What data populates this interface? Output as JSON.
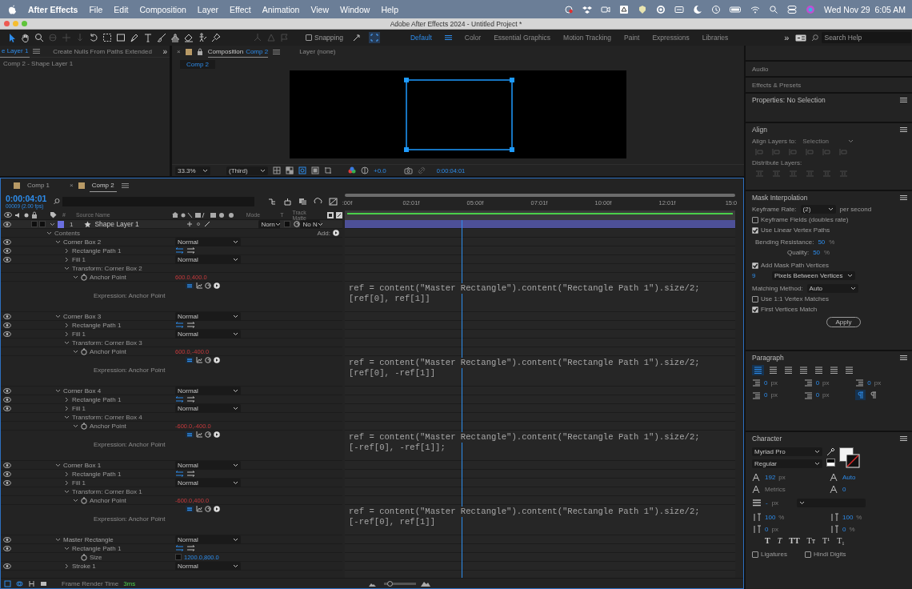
{
  "menu_bar": {
    "app": "After Effects",
    "items": [
      "File",
      "Edit",
      "Composition",
      "Layer",
      "Effect",
      "Animation",
      "View",
      "Window",
      "Help"
    ],
    "clock": "Wed Nov 29  6:05 AM"
  },
  "window": {
    "title": "Adobe After Effects 2024 - Untitled Project *"
  },
  "toolbar": {
    "snapping": {
      "label": "Snapping",
      "checked": false
    },
    "workspaces": [
      {
        "label": "Default",
        "selected": true
      },
      {
        "label": "Color",
        "selected": false
      },
      {
        "label": "Essential Graphics",
        "selected": false
      },
      {
        "label": "Motion Tracking",
        "selected": false
      },
      {
        "label": "Paint",
        "selected": false
      },
      {
        "label": "Expressions",
        "selected": false
      },
      {
        "label": "Libraries",
        "selected": false
      }
    ],
    "overflow": "»",
    "search": {
      "placeholder": "Search Help"
    }
  },
  "effect_controls": {
    "tabs": [
      {
        "label": "e Layer 1",
        "selected": true
      },
      {
        "label": "Create Nulls From Paths Extended",
        "selected": false
      }
    ],
    "overflow": "»",
    "breadcrumb": "Comp 2 - Shape Layer 1"
  },
  "composition_panel": {
    "tabs": [
      {
        "close": "×",
        "label": "Composition",
        "comp": "Comp 2",
        "selected": true
      },
      {
        "label": "Layer (none)",
        "selected": false
      }
    ],
    "subtab": "Comp 2",
    "viewer_bar": {
      "zoom": "33.3%",
      "resolution": "(Third)",
      "exposure": "+0.0",
      "timecode": "0:00:04:01"
    }
  },
  "timeline": {
    "tabs": [
      {
        "label": "Comp 1",
        "selected": false
      },
      {
        "close": "×",
        "label": "Comp 2",
        "selected": true
      }
    ],
    "timecode": "0:00:04:01",
    "frame_info": "00009 (2.00 fps)",
    "columns": {
      "number": "#",
      "source_name": "Source Name",
      "mode": "Mode",
      "t": "T",
      "track_matte": "Track Matte"
    },
    "ruler": [
      ":00f",
      "02:01f",
      "05:00f",
      "07:01f",
      "10:00f",
      "12:01f",
      "15:0"
    ],
    "playhead": {
      "level": 0.3
    },
    "layer": {
      "number": "1",
      "name": "Shape Layer 1",
      "eye": true,
      "expanded": true,
      "color": "#6b6fe0",
      "mode": "Norn",
      "track_matte": "No N",
      "children": [
        {
          "kind": "contents",
          "label": "Contents",
          "expanded": true,
          "add": "Add:",
          "children": [
            {
              "kind": "group",
              "label": "Corner Box 2",
              "eye": true,
              "expanded": true,
              "mode": "Normal",
              "children": [
                {
                  "kind": "path",
                  "label": "Rectangle Path 1",
                  "eye": true,
                  "expanded": false
                },
                {
                  "kind": "fill",
                  "label": "Fill 1",
                  "eye": true,
                  "expanded": false,
                  "mode": "Normal"
                },
                {
                  "kind": "transform",
                  "label": "Transform: Corner Box 2",
                  "expanded": true,
                  "children": [
                    {
                      "kind": "property",
                      "label": "Anchor Point",
                      "expanded": true,
                      "value": "600.0,400.0",
                      "expression": {
                        "label": "Expression: Anchor Point",
                        "code": [
                          "ref = content(\"Master Rectangle\").content(\"Rectangle Path 1\").size/2;",
                          "[ref[0], ref[1]]"
                        ]
                      }
                    }
                  ]
                }
              ]
            },
            {
              "kind": "group",
              "label": "Corner Box 3",
              "eye": true,
              "expanded": true,
              "mode": "Normal",
              "children": [
                {
                  "kind": "path",
                  "label": "Rectangle Path 1",
                  "eye": true,
                  "expanded": false
                },
                {
                  "kind": "fill",
                  "label": "Fill 1",
                  "eye": true,
                  "expanded": false,
                  "mode": "Normal"
                },
                {
                  "kind": "transform",
                  "label": "Transform: Corner Box 3",
                  "expanded": true,
                  "children": [
                    {
                      "kind": "property",
                      "label": "Anchor Point",
                      "expanded": true,
                      "value": "600.0,-400.0",
                      "expression": {
                        "label": "Expression: Anchor Point",
                        "code": [
                          "ref = content(\"Master Rectangle\").content(\"Rectangle Path 1\").size/2;",
                          "[ref[0], -ref[1]]"
                        ]
                      }
                    }
                  ]
                }
              ]
            },
            {
              "kind": "group",
              "label": "Corner Box 4",
              "eye": true,
              "expanded": true,
              "mode": "Normal",
              "children": [
                {
                  "kind": "path",
                  "label": "Rectangle Path 1",
                  "eye": true,
                  "expanded": false
                },
                {
                  "kind": "fill",
                  "label": "Fill 1",
                  "eye": true,
                  "expanded": false,
                  "mode": "Normal"
                },
                {
                  "kind": "transform",
                  "label": "Transform: Corner Box 4",
                  "expanded": true,
                  "children": [
                    {
                      "kind": "property",
                      "label": "Anchor Point",
                      "expanded": true,
                      "value": "-600.0,-400.0",
                      "expression": {
                        "label": "Expression: Anchor Point",
                        "code": [
                          "ref = content(\"Master Rectangle\").content(\"Rectangle Path 1\").size/2;",
                          "[-ref[0], -ref[1]];"
                        ]
                      }
                    }
                  ]
                }
              ]
            },
            {
              "kind": "group",
              "label": "Corner Box 1",
              "eye": true,
              "expanded": true,
              "mode": "Normal",
              "children": [
                {
                  "kind": "path",
                  "label": "Rectangle Path 1",
                  "eye": true,
                  "expanded": false
                },
                {
                  "kind": "fill",
                  "label": "Fill 1",
                  "eye": true,
                  "expanded": false,
                  "mode": "Normal"
                },
                {
                  "kind": "transform",
                  "label": "Transform: Corner Box 1",
                  "expanded": true,
                  "children": [
                    {
                      "kind": "property",
                      "label": "Anchor Point",
                      "expanded": true,
                      "value": "-600.0,400.0",
                      "expression": {
                        "label": "Expression: Anchor Point",
                        "code": [
                          "ref = content(\"Master Rectangle\").content(\"Rectangle Path 1\").size/2;",
                          "[-ref[0], ref[1]]"
                        ]
                      }
                    }
                  ]
                }
              ]
            },
            {
              "kind": "group",
              "label": "Master Rectangle",
              "eye": true,
              "expanded": true,
              "mode": "Normal",
              "children": [
                {
                  "kind": "path",
                  "label": "Rectangle Path 1",
                  "eye": true,
                  "expanded": true,
                  "children": [
                    {
                      "kind": "property",
                      "label": "Size",
                      "value": "1200.0,800.0"
                    }
                  ]
                },
                {
                  "kind": "stroke",
                  "label": "Stroke 1",
                  "eye": true,
                  "expanded": false,
                  "mode": "Normal"
                }
              ]
            }
          ]
        }
      ]
    },
    "footer": {
      "label": "Frame Render Time",
      "value": "3ms"
    },
    "zoom_slider": {
      "level": 0.1
    }
  },
  "side_panels": {
    "collapsed": [
      "Audio",
      "Effects & Presets"
    ],
    "properties": "Properties: No Selection",
    "align": {
      "title": "Align",
      "align_to": "Align Layers to:",
      "target": {
        "value": "Selection",
        "disabled": true
      },
      "distribute": "Distribute Layers:"
    },
    "mask_interpolation": {
      "title": "Mask Interpolation",
      "keyframe_rate": {
        "label": "Keyframe Rate:",
        "value": "(2)",
        "unit": "per second"
      },
      "options": [
        {
          "label": "Keyframe Fields (doubles rate)",
          "checked": false
        },
        {
          "label": "Use Linear Vertex Paths",
          "checked": true
        }
      ],
      "bending": {
        "label": "Bending Resistance:",
        "value": "50",
        "unit": "%"
      },
      "quality": {
        "label": "Quality:",
        "value": "50",
        "unit": "%"
      },
      "add_vertices": {
        "label": "Add Mask Path Vertices",
        "checked": true
      },
      "spacing": {
        "value": "9",
        "mode": "Pixels Between Vertices"
      },
      "matching": {
        "label": "Matching Method:",
        "value": "Auto"
      },
      "options2": [
        {
          "label": "Use 1:1 Vertex Matches",
          "checked": false
        },
        {
          "label": "First Vertices Match",
          "checked": true
        }
      ],
      "apply": "Apply"
    },
    "paragraph": {
      "title": "Paragraph",
      "align_buttons": [
        {
          "selected": true
        },
        {
          "selected": false
        },
        {
          "selected": false
        },
        {
          "selected": false
        },
        {
          "selected": false
        },
        {
          "selected": false
        },
        {
          "selected": false
        }
      ],
      "indents": [
        {
          "value": "0",
          "unit": "px"
        },
        {
          "value": "0",
          "unit": "px"
        },
        {
          "value": "0",
          "unit": "px"
        },
        {
          "value": "0",
          "unit": "px"
        },
        {
          "value": "0",
          "unit": "px"
        }
      ],
      "direction_buttons": [
        {
          "selected": true
        },
        {
          "selected": false
        }
      ]
    },
    "character": {
      "title": "Character",
      "font": "Myriad Pro",
      "style": "Regular",
      "metrics": [
        {
          "value": "192",
          "unit": "px",
          "disabled": false
        },
        {
          "value": "Auto",
          "disabled": false
        },
        {
          "value": "Metrics",
          "disabled": true
        },
        {
          "value": "0",
          "disabled": false
        }
      ],
      "stroke": {
        "value": "-",
        "unit": "px"
      },
      "scales": [
        {
          "value": "100",
          "unit": "%"
        },
        {
          "value": "100",
          "unit": "%"
        },
        {
          "value": "0",
          "unit": "px"
        },
        {
          "value": "0",
          "unit": "%"
        }
      ],
      "styles": [
        {
          "label": "T",
          "kind": "bold"
        },
        {
          "label": "T",
          "kind": "italic"
        },
        {
          "label": "TT",
          "kind": "caps"
        },
        {
          "label": "Tᴛ",
          "kind": "small-caps"
        },
        {
          "label": "T¹",
          "kind": "super"
        },
        {
          "label": "T₁",
          "kind": "sub"
        }
      ],
      "options": [
        {
          "label": "Ligatures",
          "checked": false
        },
        {
          "label": "Hindi Digits",
          "checked": false
        }
      ]
    }
  }
}
